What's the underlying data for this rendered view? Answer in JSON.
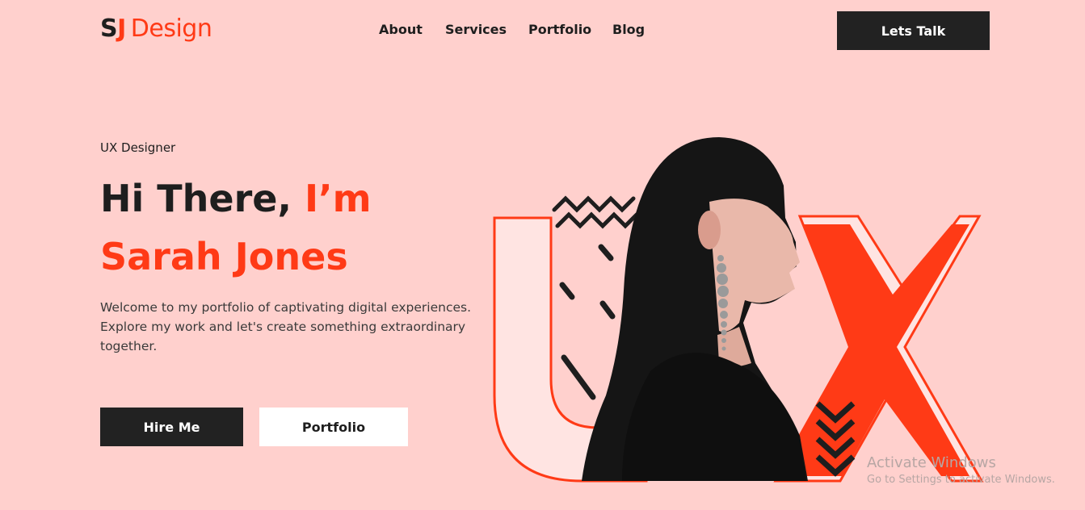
{
  "header": {
    "logo_mark_s": "S",
    "logo_mark_j": "J",
    "logo_word": "Design",
    "nav": [
      "About",
      "Services",
      "Portfolio",
      "Blog"
    ],
    "cta": "Lets Talk"
  },
  "hero": {
    "role": "UX Designer",
    "greeting": "Hi There, ",
    "greeting_accent": "I’m",
    "name": "Sarah Jones",
    "intro": "Welcome to my portfolio of captivating digital experiences. Explore my work and let's create something extraordinary together.",
    "primary_button": "Hire Me",
    "secondary_button": "Portfolio"
  },
  "watermark": {
    "title": "Activate Windows",
    "subtitle": "Go to Settings to activate Windows."
  },
  "colors": {
    "background": "#ffd0cd",
    "accent": "#ff3a16",
    "dark": "#222222",
    "white": "#ffffff"
  }
}
